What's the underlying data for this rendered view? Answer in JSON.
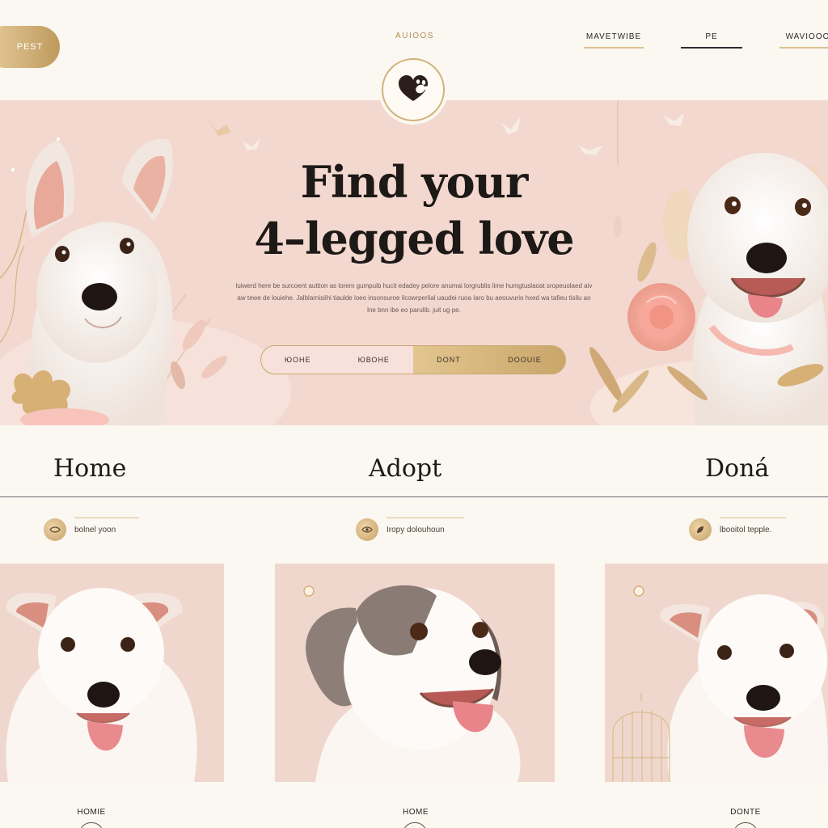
{
  "header": {
    "brand": "PEST",
    "top_label": "AUIOOS",
    "nav": [
      {
        "label": "MAVETWIBE"
      },
      {
        "label": "PE"
      },
      {
        "label": "WAVIOOO"
      }
    ],
    "logo": "heart-paw-icon"
  },
  "hero": {
    "title_line1": "Find your",
    "title_line2": "4–legged love",
    "description": "luiwerd here be surcoent auttion as lorem gumpuib hucit edadey pelore anumai lorgrublis lime humgtuslaoat sropeuolaed aiv aw tewe de louiehe. Jalblarnisiihi tiaulde loeo insonsuroe ilcowrperlial uaudei ruoa Iaro bu aeouvurio hxed wa tafieu tisilu ao lne bnn ibe eo parulib. juit ug pe.",
    "cta_buttons": [
      {
        "label_a": "ЮОНЕ",
        "label_b": "ЮВОНЕ"
      },
      {
        "label_a": "DONT",
        "label_b": "DOOUIE"
      }
    ],
    "colors": {
      "background": "#f3d8cf",
      "accent": "#c9a66a"
    }
  },
  "tabs": [
    {
      "label": "Home"
    },
    {
      "label": "Adopt"
    },
    {
      "label": "Doná"
    }
  ],
  "meta": [
    {
      "text": "bolnel yoon"
    },
    {
      "text": "Iropy dolouhoun"
    },
    {
      "text": "lbooitol tepple."
    }
  ],
  "cards": [
    {
      "label": "HOMIE",
      "image": "white-puppy"
    },
    {
      "label": "HOME",
      "image": "grey-white-puppy"
    },
    {
      "label": "DONTE",
      "image": "white-puppy"
    }
  ]
}
